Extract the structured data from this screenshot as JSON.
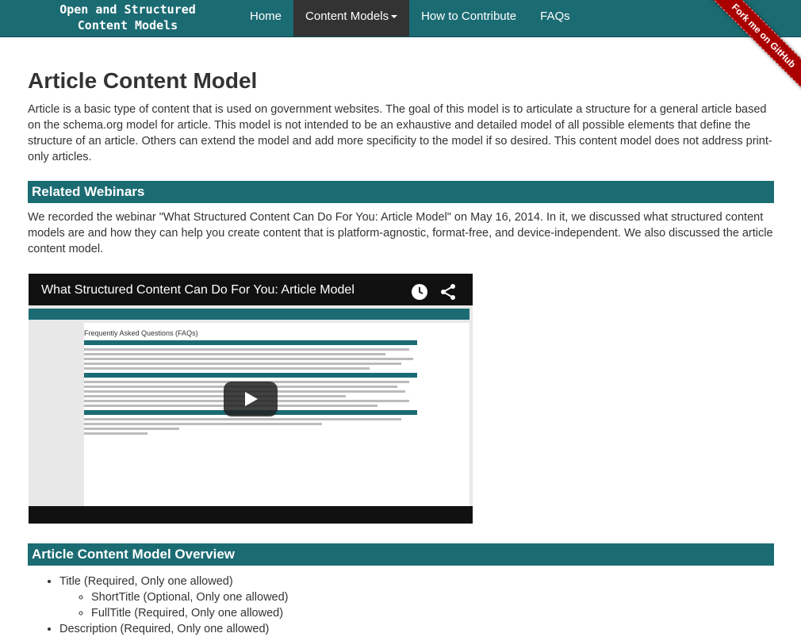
{
  "navbar": {
    "brand_line1": "Open and Structured",
    "brand_line2": "Content Models",
    "items": [
      {
        "label": "Home"
      },
      {
        "label": "Content Models"
      },
      {
        "label": "How to Contribute"
      },
      {
        "label": "FAQs"
      }
    ],
    "ribbon": "Fork me on GitHub"
  },
  "page": {
    "title": "Article Content Model",
    "intro": "Article is a basic type of content that is used on government websites. The goal of this model is to articulate a structure for a general article based on the schema.org model for article. This model is not intended to be an exhaustive and detailed model of all possible elements that define the structure of an article. Others can extend the model and add more specificity to the model if so desired. This content model does not address print-only articles."
  },
  "webinars": {
    "heading": "Related Webinars",
    "text": "We recorded the webinar \"What Structured Content Can Do For You: Article Model\" on May 16, 2014. In it, we discussed what structured content models are and how they can help you create content that is platform-agnostic, format-free, and device-independent. We also discussed the article content model.",
    "video_title": "What Structured Content Can Do For You: Article Model",
    "video_inner_heading": "Frequently Asked Questions (FAQs)"
  },
  "overview": {
    "heading": "Article Content Model Overview",
    "items": [
      {
        "label": "Title (Required, Only one allowed)",
        "children": [
          {
            "label": "ShortTitle (Optional, Only one allowed)"
          },
          {
            "label": "FullTitle (Required, Only one allowed)"
          }
        ]
      },
      {
        "label": "Description (Required, Only one allowed)"
      }
    ]
  },
  "colors": {
    "brand": "#1b6b73",
    "active_nav": "#333333",
    "ribbon": "#aa0000"
  }
}
